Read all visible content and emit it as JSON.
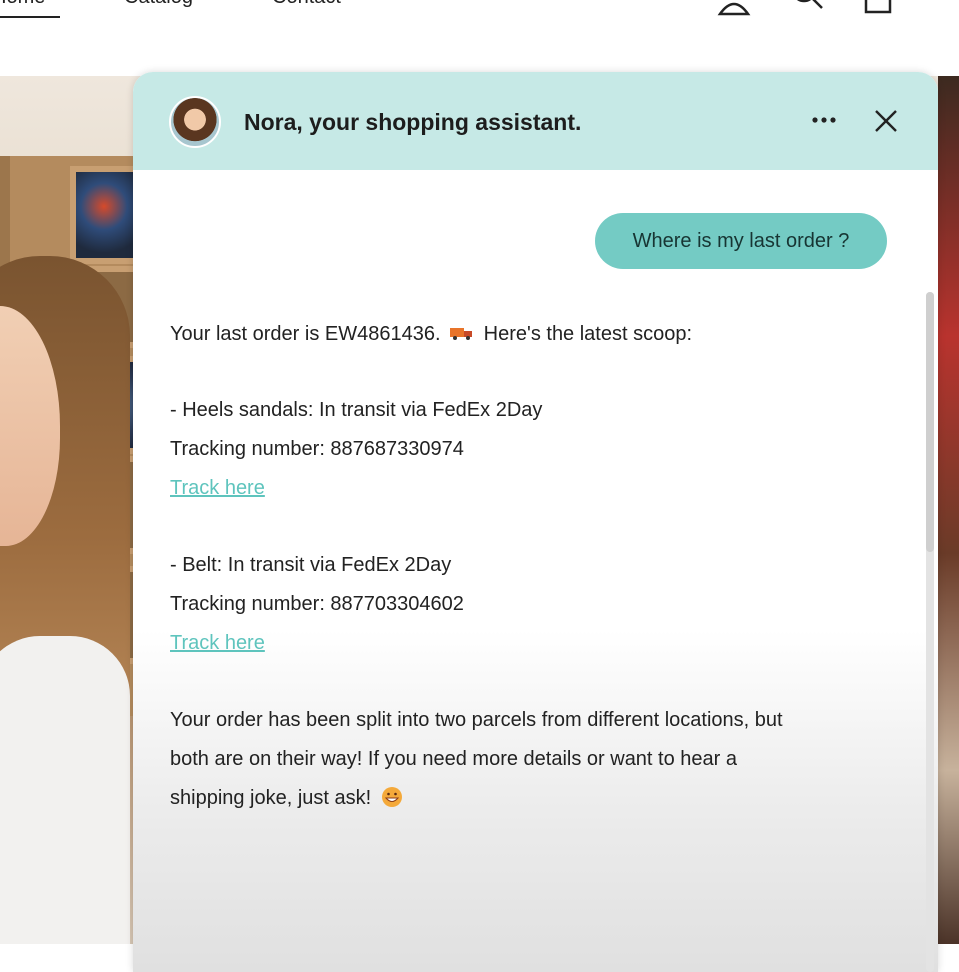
{
  "nav": {
    "home": "Home",
    "catalog": "Catalog",
    "contact": "Contact"
  },
  "chat": {
    "title": "Nora, your shopping assistant.",
    "user_message": "Where is my last order ?",
    "reply": {
      "intro_a": "Your last order is EW4861436.",
      "intro_b": "Here's the latest scoop:",
      "item1_status": "- Heels sandals: In transit via FedEx 2Day",
      "item1_tracking": "Tracking number: 887687330974",
      "item1_link": "Track here",
      "item2_status": "- Belt: In transit via FedEx 2Day",
      "item2_tracking": "Tracking number: 887703304602",
      "item2_link": "Track here",
      "closing_1": "Your order has been split into two parcels from different locations, but",
      "closing_2": "both are on their way! If you need more details or want to hear a",
      "closing_3": "shipping joke, just ask!"
    }
  },
  "colors": {
    "header_bg": "#c6e9e6",
    "user_bubble": "#74cbc4",
    "link": "#5ec4bd"
  },
  "icons": [
    "account-icon",
    "search-icon",
    "cart-icon",
    "more-options-icon",
    "close-icon",
    "delivery-truck-emoji",
    "grinning-face-emoji"
  ]
}
